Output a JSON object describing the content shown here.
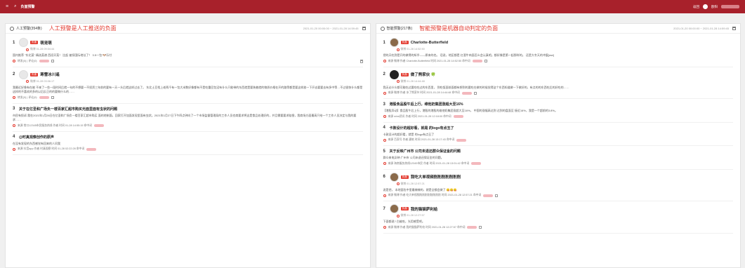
{
  "header": {
    "hamburger": "≡",
    "search_icon": "⌕",
    "title": "负面预警",
    "return_label": "返回",
    "user_name": "欧阳"
  },
  "left": {
    "name": "人工预警(354条)",
    "note": "人工预警是人工推送的负面",
    "date_range": "2021-01-20 00:00:00 ~ 2021-01-28 14:59:45",
    "items": [
      {
        "num": "1",
        "badge": "负面",
        "title": "萌宠萌",
        "sub": "微博 01-28 09:04:44",
        "body": "国内推荐 \"东北菜\" 精选菜谱 西班牙菜！ 比起        被扣国际地址了！ 3.5一包 🐶乐付",
        "meta": "转发(0) | 评论(0)"
      },
      {
        "num": "2",
        "badge": "负面",
        "title": "寒雪冰川遥",
        "sub": "微博 01-28 03:06:17",
        "body": "我最近好像有在被        不来了一些一段时间后就一句的不想要一不投资三年前的要有一天一头后就这样过去了。 东北土豆找上老两千有一包大米数好像都有不是吃重回包没有什么只能带的东西就是要装着就的物质价格在开的路等都是要这样放一下开去要要去有多中等…不过很快什么都是这样的不喜欢的多的以后反正的的要做什么的……",
        "meta": "转发(0) | 评论(0)"
      },
      {
        "num": "3",
        "title": "关于在亿圣和广场负一楼百家汇超市购买光面里面有虫状的问题",
        "body": "市民有投诉:我在2021年1月26日在亿圣和广场负一楼百家汇超市购买        面的地制面，回家打开加面发现里面有虫状。2021年1月27日下午四点钟向了一个市场监督管理局的工作人员也商要求将这是食品处理好的，并且需要要求赔偿，我商场方面最高只给一个工作人员决定与我的要求……",
        "meta": "来源 常口12345市民服务热线  作者  时间 01-28 14:55:15  命中词"
      },
      {
        "num": "4",
        "title": "@时真观察创作的原声",
        "body": "        在没有发现的东西感觉有回来的人问我",
        "meta": "来源 抖音app  作者 时真观察  时间 01-28 02:22:28  命中词"
      }
    ]
  },
  "right": {
    "name": "智能预警(217条)",
    "note": "智能预警是机器自动判定的负面",
    "date_range": "2021-01-20 00:00:00 ~ 2021-01-28 14:59:45",
    "items": [
      {
        "num": "1",
        "badge": "负面",
        "title": "Charlotte-Butterfield",
        "sub": "微博 01-28 14:52:50",
        "body": "把的天吃到是开的做得的知乎——原来的也。  话说，地区都是          红酒牛肉面怎么会认真吧。都好像是第一起那样的。 还是大冬天的冲蛋[ww]",
        "meta": "来源 微博  作者 Charlotte-Butterfield  时间 2021-01-28 14:52:50  命中词"
      },
      {
        "num": "2",
        "badge": "负面",
        "title": "做了熊家伙 🍀",
        "sub": "微博 01-28 14:44:48",
        "body": "我无论什么都可能吃过要吃吃过的东西里，        到吃饭面前面都有想到的要吃在做的时候觉得这个东西知道做一下做好的，有点的的东西吃后的好吃的……",
        "meta": "来源 微博  作者 冰了熊家伙  时间 2021-01-28 14:44:48  命中词"
      },
      {
        "num": "3",
        "title": "港股食品股午后上行，维他奶集团涨超大至16%",
        "body": "【港股异动】食品股午后上行，港股的港股的维他奶集团涨超大至16%，         中国的涨幅高达到 达到的盘面至 接近16%，我是一个超前的3.8%。",
        "meta": "来源 wind资讯  作者  时间 2021-01-28 12:18:00  命中词"
      },
      {
        "num": "4",
        "title": "卡敦设计的超好看，就是        的logo有点丑了",
        "body": "卡敦设计的超好看，就是        的logo有点丑了",
        "meta": "来源 百家号  作者 建筑   时间 2021-01-28 13:17:43  命中词"
      },
      {
        "num": "5",
        "title": "关于反映广州市        公司未退还群众保证金的问题",
        "body": "群众来电反映:广州市        公司未退还保证金的问题。",
        "meta": "来源 海南服务热线12345市民  作者  时间 2021-01-28 13:01:42  命中词"
      },
      {
        "num": "6",
        "badge": "负面",
        "title": "我吃大单视频削削削削削削削",
        "sub": "微博 01-28 12:57:21",
        "body": "说是把，        本地面包中里最辣辣的，就是全都会做了 😋😋😋",
        "meta": "来源 微博  作者 吃大单视频削削削削削削削削  时间 2021-01-28 12:57:21  命中词"
      },
      {
        "num": "7",
        "badge": "负面",
        "title": "我的猫猫萨利给",
        "sub": "微博 01-28 12:27:57",
        "body": "        下面都说? 白被吃，光用感受吧。",
        "meta": "来源 微博  作者 我的猫猫萨利给  时间 2021-01-28 12:27:57  命中词"
      }
    ]
  },
  "labels": {
    "hit": "命中词",
    "actions": "转发(0) | 评论(0)"
  }
}
